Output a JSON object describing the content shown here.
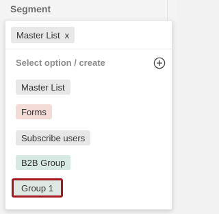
{
  "header": {
    "label": "Segment"
  },
  "selected": {
    "chip_label": "Master List",
    "remove_glyph": "x"
  },
  "dropdown": {
    "section_label": "Select option / create",
    "add_icon": "plus-circle-icon",
    "options": [
      {
        "label": "Master List",
        "color": "#e7e7e7"
      },
      {
        "label": "Forms",
        "color": "#f3dcd8"
      },
      {
        "label": "Subscribe users",
        "color": "#e7e7e7"
      },
      {
        "label": "B2B Group",
        "color": "#d6e9e3"
      },
      {
        "label": "Group 1",
        "color": "#dfe9e3",
        "highlighted": true,
        "highlight_color": "#a5161e"
      }
    ]
  }
}
